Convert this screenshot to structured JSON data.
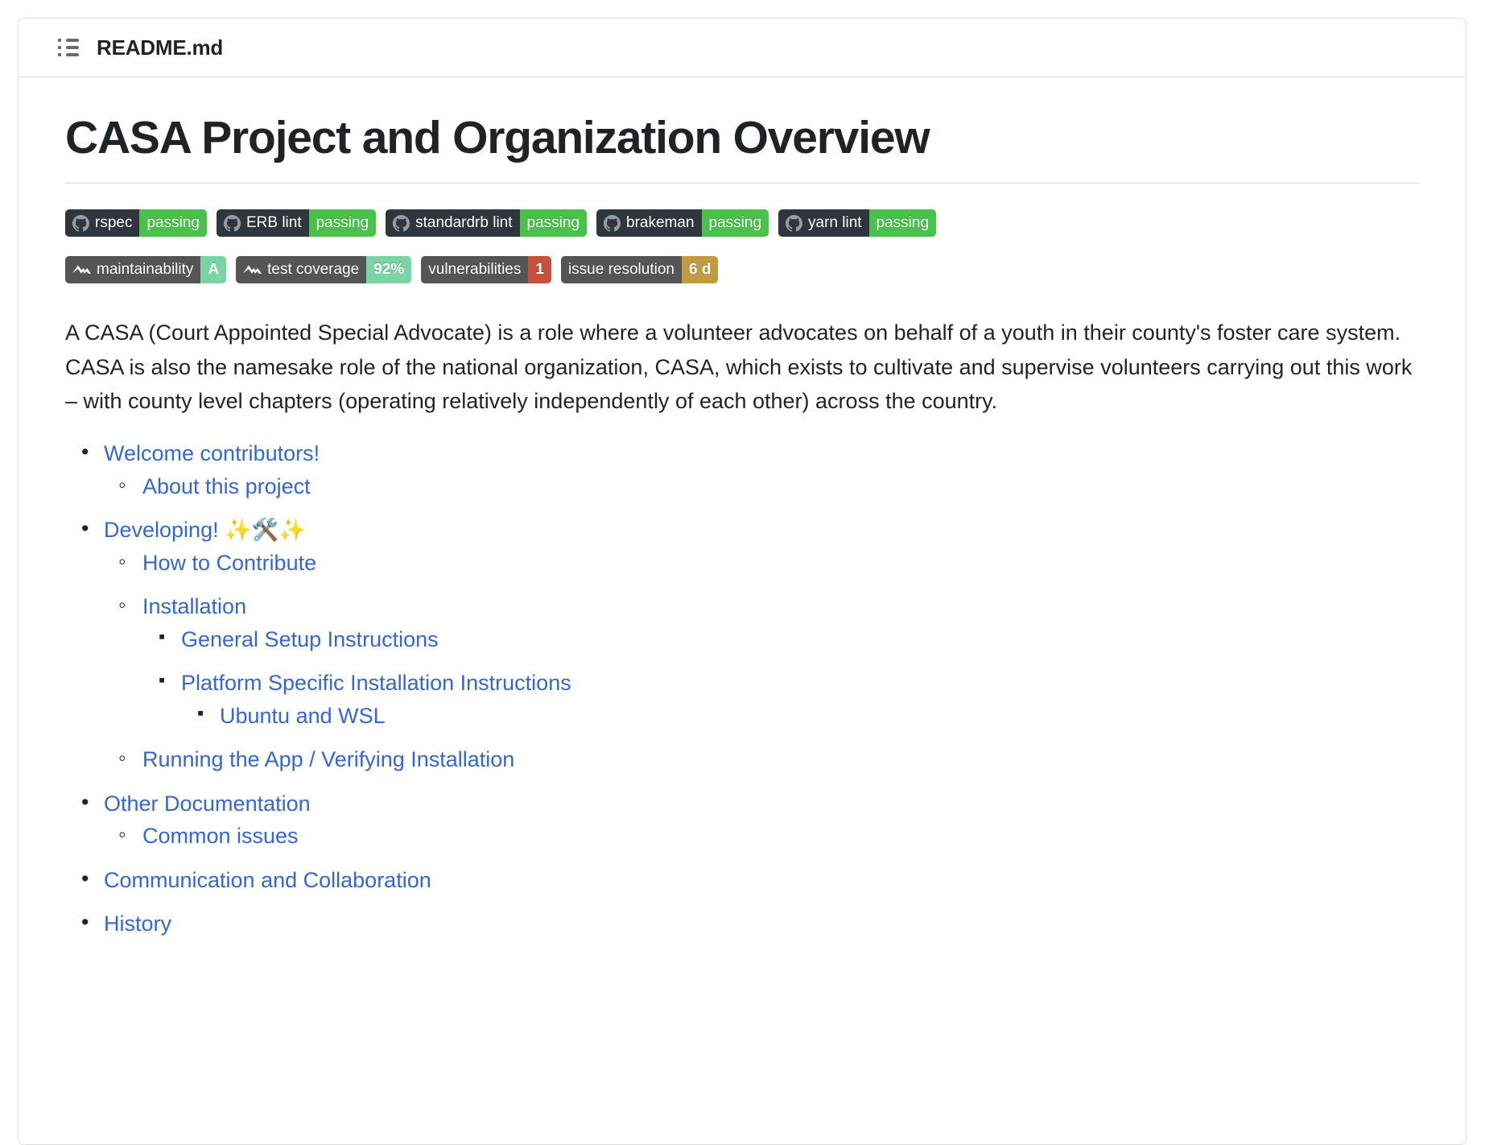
{
  "header": {
    "icon": "bulleted-list-icon",
    "file_name": "README.md"
  },
  "title": "CASA Project and Organization Overview",
  "badges": {
    "row1_style": "github-actions",
    "row1": [
      {
        "icon": "github-mark-icon",
        "label": "rspec",
        "value": "passing",
        "value_color": "#4ac14a"
      },
      {
        "icon": "github-mark-icon",
        "label": "ERB lint",
        "value": "passing",
        "value_color": "#4ac14a"
      },
      {
        "icon": "github-mark-icon",
        "label": "standardrb lint",
        "value": "passing",
        "value_color": "#4ac14a"
      },
      {
        "icon": "github-mark-icon",
        "label": "brakeman",
        "value": "passing",
        "value_color": "#4ac14a"
      },
      {
        "icon": "github-mark-icon",
        "label": "yarn lint",
        "value": "passing",
        "value_color": "#4ac14a"
      }
    ],
    "row2_style": "code-climate",
    "row2": [
      {
        "icon": "code-climate-icon",
        "label": "maintainability",
        "value": "A",
        "value_color": "#7ad4a4",
        "value_class": "mint"
      },
      {
        "icon": "code-climate-icon",
        "label": "test coverage",
        "value": "92%",
        "value_color": "#7ad4a4",
        "value_class": "mint"
      },
      {
        "icon": null,
        "label": "vulnerabilities",
        "value": "1",
        "value_color": "#c5513c",
        "value_class": "red"
      },
      {
        "icon": null,
        "label": "issue resolution",
        "value": "6 d",
        "value_color": "#c29b40",
        "value_class": "gold"
      }
    ],
    "label_bg_row1": "#2f363d",
    "label_bg_row2": "#555555"
  },
  "intro_paragraph": "A CASA (Court Appointed Special Advocate) is a role where a volunteer advocates on behalf of a youth in their county's foster care system. CASA is also the namesake role of the national organization, CASA, which exists to cultivate and supervise volunteers carrying out this work – with county level chapters (operating relatively independently of each other) across the country.",
  "toc": {
    "link_color": "#3366d6",
    "items": [
      {
        "level": 1,
        "label": "Welcome contributors!"
      },
      {
        "level": 2,
        "label": "About this project"
      },
      {
        "level": 1,
        "label": "Developing! ✨🛠️✨"
      },
      {
        "level": 2,
        "label": "How to Contribute"
      },
      {
        "level": 2,
        "label": "Installation"
      },
      {
        "level": 3,
        "label": "General Setup Instructions"
      },
      {
        "level": 3,
        "label": "Platform Specific Installation Instructions"
      },
      {
        "level": 4,
        "label": "Ubuntu and WSL"
      },
      {
        "level": 2,
        "label": "Running the App / Verifying Installation"
      },
      {
        "level": 1,
        "label": "Other Documentation"
      },
      {
        "level": 2,
        "label": "Common issues"
      },
      {
        "level": 1,
        "label": "Communication and Collaboration"
      },
      {
        "level": 1,
        "label": "History"
      }
    ]
  }
}
